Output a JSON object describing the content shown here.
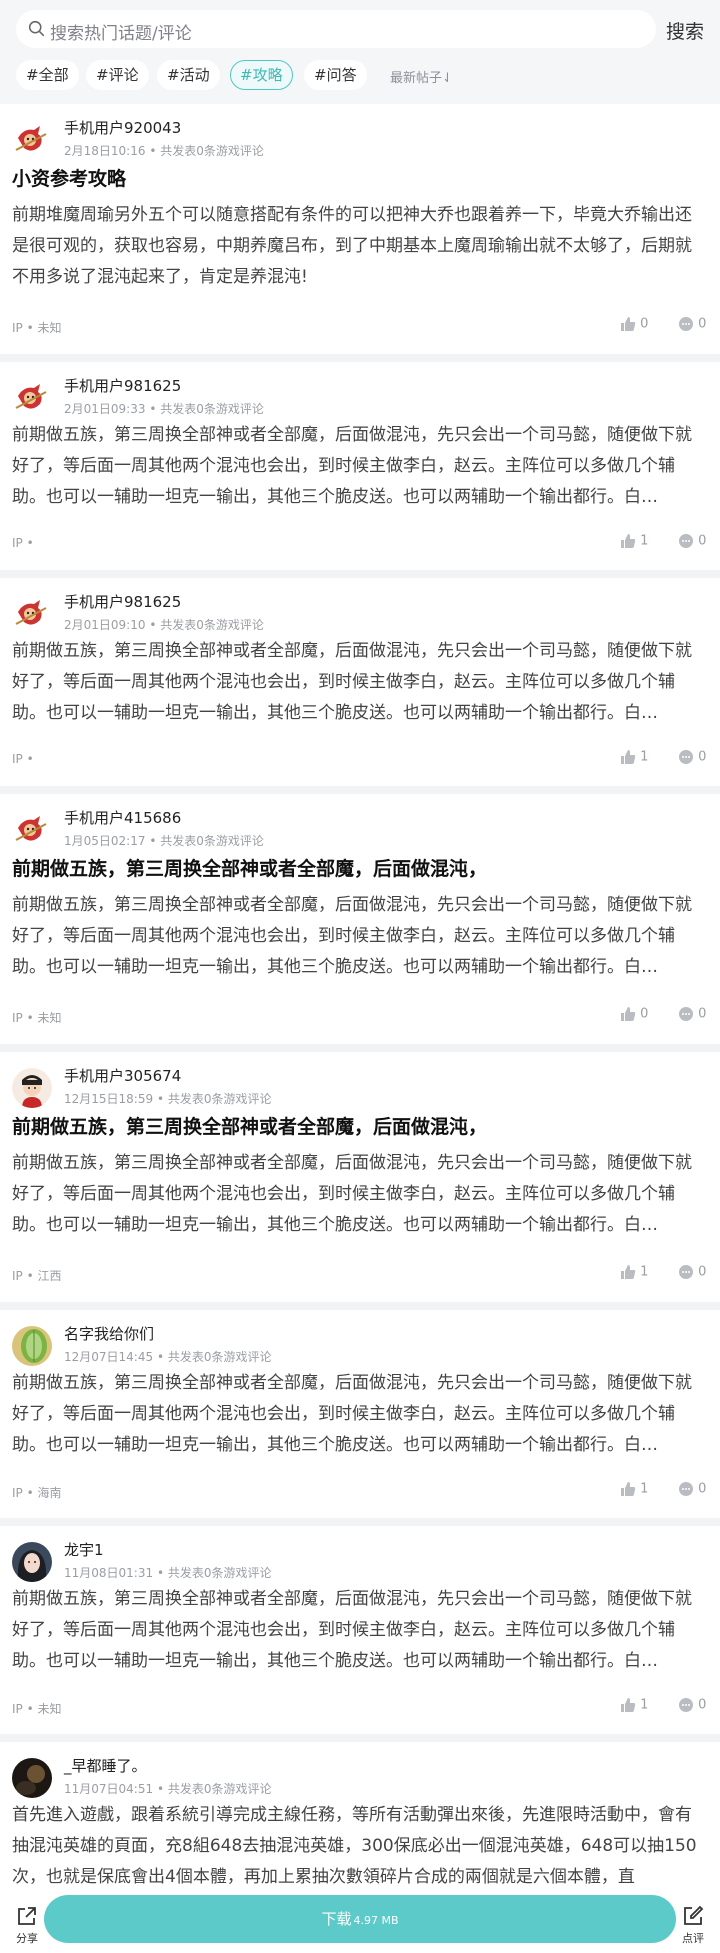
{
  "search": {
    "placeholder": "搜索热门话题/评论",
    "button": "搜索"
  },
  "tabs": [
    "#全部",
    "#评论",
    "#活动",
    "#攻略",
    "#问答"
  ],
  "sort_label": "最新帖子⇃",
  "colors": {
    "accent": "#4fc7c5",
    "download": "#5ccac9"
  },
  "posts": [
    {
      "username": "手机用户920043",
      "time": "2月18日10:16",
      "meta_suffix": "• 共发表0条游戏评论",
      "avatar": "monkey-king",
      "title": "小资参考攻略",
      "body": "前期堆魔周瑜另外五个可以随意搭配有条件的可以把神大乔也跟着养一下，毕竟大乔输出还是很可观的，获取也容易，中期养魔吕布，到了中期基本上魔周瑜输出就不太够了，后期就不用多说了混沌起来了，肯定是养混沌!",
      "ip": "IP • 未知",
      "likes": "0",
      "comments": "0"
    },
    {
      "username": "手机用户981625",
      "time": "2月01日09:33",
      "meta_suffix": "• 共发表0条游戏评论",
      "avatar": "monkey-king",
      "title": "",
      "body": "前期做五族，第三周换全部神或者全部魔，后面做混沌，先只会出一个司马懿，随便做下就好了，等后面一周其他两个混沌也会出，到时候主做李白，赵云。主阵位可以多做几个辅助。也可以一辅助一坦克一输出，其他三个脆皮送。也可以两辅助一个输出都行。白…",
      "ip": "IP •",
      "likes": "1",
      "comments": "0"
    },
    {
      "username": "手机用户981625",
      "time": "2月01日09:10",
      "meta_suffix": "• 共发表0条游戏评论",
      "avatar": "monkey-king",
      "title": "",
      "body": "前期做五族，第三周换全部神或者全部魔，后面做混沌，先只会出一个司马懿，随便做下就好了，等后面一周其他两个混沌也会出，到时候主做李白，赵云。主阵位可以多做几个辅助。也可以一辅助一坦克一输出，其他三个脆皮送。也可以两辅助一个输出都行。白…",
      "ip": "IP •",
      "likes": "1",
      "comments": "0"
    },
    {
      "username": "手机用户415686",
      "time": "1月05日02:17",
      "meta_suffix": "• 共发表0条游戏评论",
      "avatar": "monkey-king",
      "title": "前期做五族，第三周换全部神或者全部魔，后面做混沌，",
      "body": "前期做五族，第三周换全部神或者全部魔，后面做混沌，先只会出一个司马懿，随便做下就好了，等后面一周其他两个混沌也会出，到时候主做李白，赵云。主阵位可以多做几个辅助。也可以一辅助一坦克一输出，其他三个脆皮送。也可以两辅助一个输出都行。白…",
      "ip": "IP • 未知",
      "likes": "0",
      "comments": "0"
    },
    {
      "username": "手机用户305674",
      "time": "12月15日18:59",
      "meta_suffix": "• 共发表0条游戏评论",
      "avatar": "cartoon-boy",
      "title": "前期做五族，第三周换全部神或者全部魔，后面做混沌，",
      "body": "前期做五族，第三周换全部神或者全部魔，后面做混沌，先只会出一个司马懿，随便做下就好了，等后面一周其他两个混沌也会出，到时候主做李白，赵云。主阵位可以多做几个辅助。也可以一辅助一坦克一输出，其他三个脆皮送。也可以两辅助一个输出都行。白…",
      "ip": "IP • 江西",
      "likes": "1",
      "comments": "0"
    },
    {
      "username": "名字我给你们",
      "time": "12月07日14:45",
      "meta_suffix": "• 共发表0条游戏评论",
      "avatar": "melon-photo",
      "title": "",
      "body": "前期做五族，第三周换全部神或者全部魔，后面做混沌，先只会出一个司马懿，随便做下就好了，等后面一周其他两个混沌也会出，到时候主做李白，赵云。主阵位可以多做几个辅助。也可以一辅助一坦克一输出，其他三个脆皮送。也可以两辅助一个输出都行。白…",
      "ip": "IP • 海南",
      "likes": "1",
      "comments": "0"
    },
    {
      "username": "龙宇1",
      "time": "11月08日01:31",
      "meta_suffix": "• 共发表0条游戏评论",
      "avatar": "girl-photo",
      "title": "",
      "body": "前期做五族，第三周换全部神或者全部魔，后面做混沌，先只会出一个司马懿，随便做下就好了，等后面一周其他两个混沌也会出，到时候主做李白，赵云。主阵位可以多做几个辅助。也可以一辅助一坦克一输出，其他三个脆皮送。也可以两辅助一个输出都行。白…",
      "ip": "IP • 未知",
      "likes": "1",
      "comments": "0"
    },
    {
      "username": "_早都睡了。",
      "time": "11月07日04:51",
      "meta_suffix": "• 共发表0条游戏评论",
      "avatar": "dark-photo",
      "title": "",
      "body": "首先進入遊戲，跟着系統引導完成主線任務，等所有活動彈出來後，先進限時活動中，會有抽混沌英雄的頁面，充8組648去抽混沌英雄，300保底必出一個混沌英雄，648可以抽150次，也就是保底會出4個本體，再加上累抽次數領碎片合成的兩個就是六個本體，直",
      "ip": "",
      "likes": "",
      "comments": ""
    }
  ],
  "bottom": {
    "share": "分享",
    "download": "下载",
    "size": "4.97 MB",
    "review": "点评"
  }
}
